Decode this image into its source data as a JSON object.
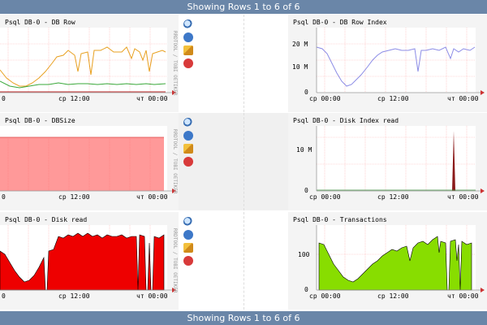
{
  "header": {
    "rows_text": "Showing Rows 1 to 6 of 6"
  },
  "footer": {
    "rows_text": "Showing Rows 1 to 6 of 6"
  },
  "side_label": "RRDTOOL / TOBI OETIKER",
  "icon_names": [
    "zoom-icon",
    "info-icon",
    "edit-icon",
    "delete-icon"
  ],
  "colors": {
    "bar": "#6a86a8",
    "grid": "#ff9999",
    "axis": "#999999"
  },
  "graphs": [
    {
      "title": "Psql DB-0 - DB Row",
      "x_labels": [
        "",
        "ср 12:00",
        "чт 00:00"
      ],
      "x_first": "0",
      "y_labels": []
    },
    {
      "title": "Psql DB-0 - DB Row Index",
      "x_labels": [
        "ср 00:00",
        "ср 12:00",
        "чт 00:00"
      ],
      "y_labels": [
        "20 M",
        "10 M",
        "0"
      ]
    },
    {
      "title": "Psql DB-0 - DBSize",
      "x_labels": [
        "0",
        "ср 12:00",
        "чт 00:00"
      ],
      "y_labels": []
    },
    {
      "title": "Psql DB-0 - Disk Index read",
      "x_labels": [
        "ср 00:00",
        "ср 12:00",
        "чт 00:00"
      ],
      "y_labels": [
        "10 M",
        "0"
      ]
    },
    {
      "title": "Psql DB-0 - Disk read",
      "x_labels": [
        "0",
        "ср 12:00",
        "чт 00:00"
      ],
      "y_labels": []
    },
    {
      "title": "Psql DB-0 - Transactions",
      "x_labels": [
        "ср 00:00",
        "ср 12:00",
        "чт 00:00"
      ],
      "y_labels": [
        "100",
        "0"
      ]
    }
  ]
}
